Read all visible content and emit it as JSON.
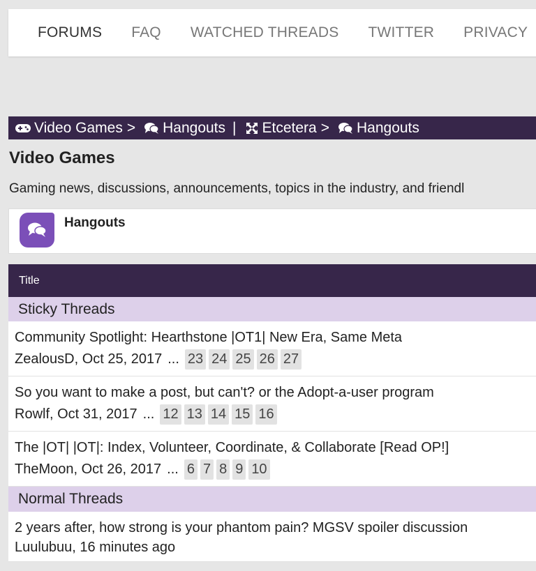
{
  "nav": {
    "items": [
      "FORUMS",
      "FAQ",
      "WATCHED THREADS",
      "TWITTER",
      "PRIVACY"
    ]
  },
  "breadcrumb": {
    "trail_a": [
      "Video Games",
      "Hangouts"
    ],
    "trail_b": [
      "Etcetera",
      "Hangouts"
    ],
    "chevron": ">",
    "divider": "|"
  },
  "page": {
    "title": "Video Games",
    "description": "Gaming news, discussions, announcements, topics in the industry, and friendl"
  },
  "forum": {
    "name": "Hangouts",
    "icon": "chat-bubbles-icon"
  },
  "table": {
    "header": "Title",
    "sticky_label": "Sticky Threads",
    "normal_label": "Normal Threads"
  },
  "threads": {
    "sticky": [
      {
        "title": "Community Spotlight: Hearthstone |OT1| New Era, Same Meta",
        "author_date": "ZealousD, Oct 25, 2017",
        "ellipsis": "...",
        "pages": [
          "23",
          "24",
          "25",
          "26",
          "27"
        ]
      },
      {
        "title": "So you want to make a post, but can't? or the Adopt-a-user program",
        "author_date": "Rowlf, Oct 31, 2017",
        "ellipsis": "...",
        "pages": [
          "12",
          "13",
          "14",
          "15",
          "16"
        ]
      },
      {
        "title": "The |OT| |OT|: Index, Volunteer, Coordinate, & Collaborate [Read OP!]",
        "author_date": "TheMoon, Oct 26, 2017",
        "ellipsis": "...",
        "pages": [
          "6",
          "7",
          "8",
          "9",
          "10"
        ]
      }
    ],
    "normal": [
      {
        "title": "2 years after, how strong is your phantom pain? MGSV spoiler discussion",
        "author_date": "Luulubuu, 16 minutes ago"
      }
    ]
  },
  "colors": {
    "brand_dark": "#37264a",
    "section_bg": "#ddd0ea",
    "forum_icon_bg": "#7b4fb8"
  }
}
